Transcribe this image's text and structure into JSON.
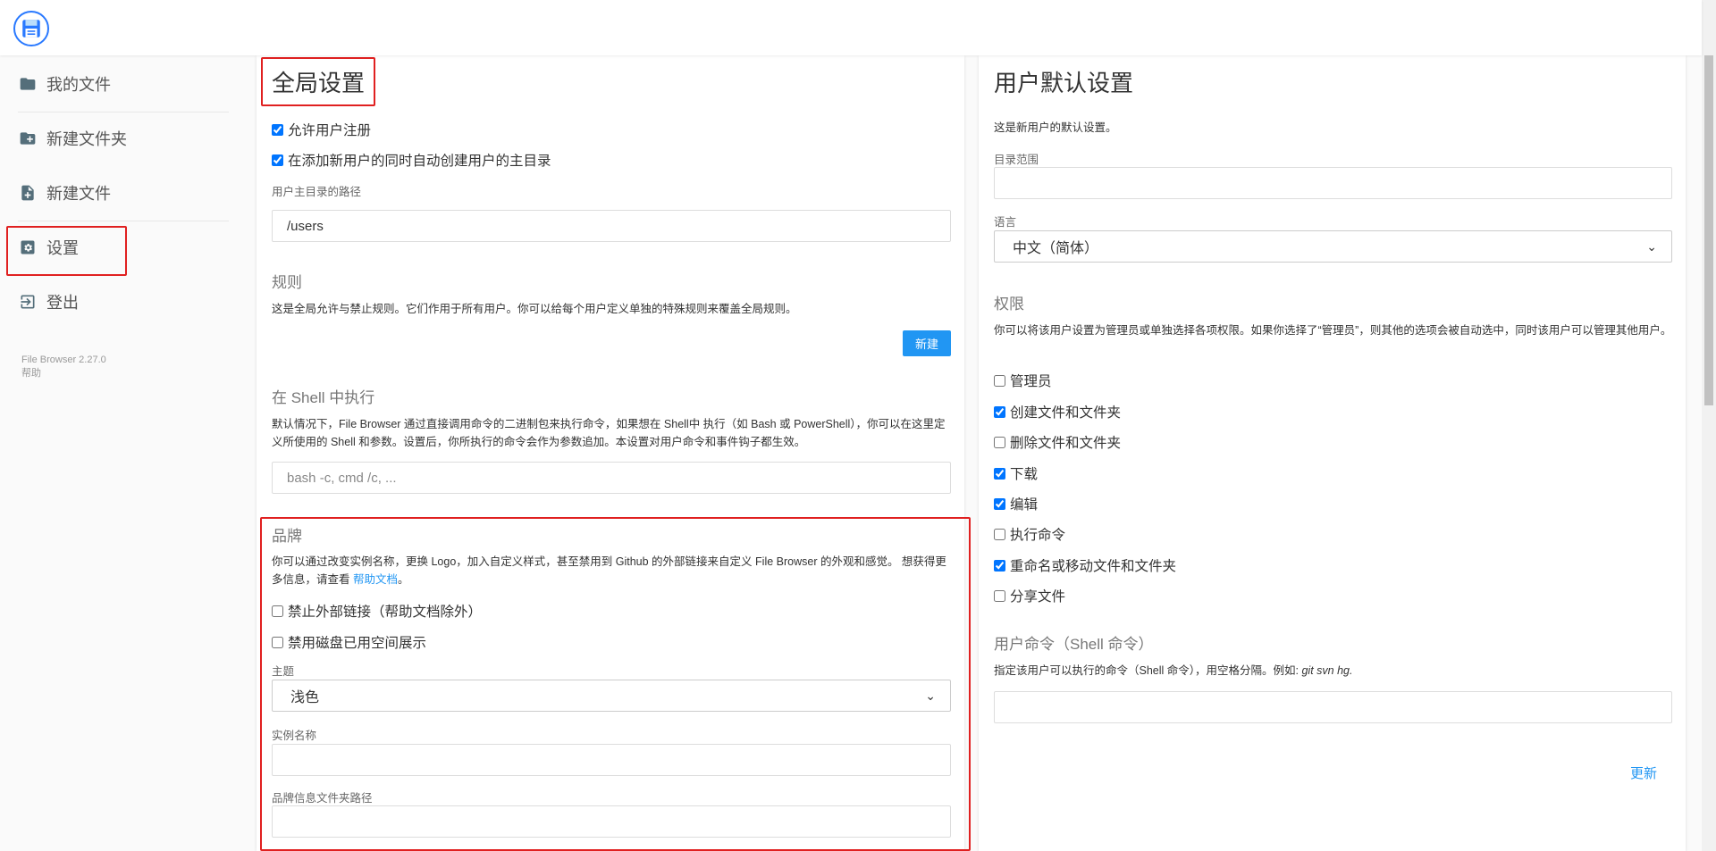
{
  "sidebar": {
    "items": [
      {
        "label": "我的文件",
        "icon": "folder-icon"
      },
      {
        "label": "新建文件夹",
        "icon": "folder-plus-icon"
      },
      {
        "label": "新建文件",
        "icon": "file-plus-icon"
      },
      {
        "label": "设置",
        "icon": "gear-icon"
      },
      {
        "label": "登出",
        "icon": "logout-icon"
      }
    ],
    "version": "File Browser 2.27.0",
    "help": "帮助"
  },
  "global": {
    "title": "全局设置",
    "allow_signup": "允许用户注册",
    "create_home": "在添加新用户的同时自动创建用户的主目录",
    "home_path_label": "用户主目录的路径",
    "home_path_value": "/users",
    "rules_title": "规则",
    "rules_desc": "这是全局允许与禁止规则。它们作用于所有用户。你可以给每个用户定义单独的特殊规则来覆盖全局规则。",
    "new_button": "新建",
    "shell_title": "在 Shell 中执行",
    "shell_desc": "默认情况下，File Browser 通过直接调用命令的二进制包来执行命令，如果想在 Shell中 执行（如 Bash 或 PowerShell），你可以在这里定义所使用的 Shell 和参数。设置后，你所执行的命令会作为参数追加。本设置对用户命令和事件钩子都生效。",
    "shell_placeholder": "bash -c, cmd /c, ...",
    "branding_title": "品牌",
    "branding_desc": "你可以通过改变实例名称，更换 Logo，加入自定义样式，甚至禁用到 Github 的外部链接来自定义 File Browser 的外观和感觉。 想获得更多信息，请查看",
    "branding_link": "帮助文档",
    "branding_end": "。",
    "disable_external": "禁止外部链接（帮助文档除外）",
    "disable_disk": "禁用磁盘已用空间展示",
    "theme_label": "主题",
    "theme_value": "浅色",
    "instance_label": "实例名称",
    "branding_dir_label": "品牌信息文件夹路径"
  },
  "defaults": {
    "title": "用户默认设置",
    "intro": "这是新用户的默认设置。",
    "scope_label": "目录范围",
    "lang_label": "语言",
    "lang_value": "中文（简体）",
    "perm_title": "权限",
    "perm_desc": "你可以将该用户设置为管理员或单独选择各项权限。如果你选择了“管理员”，则其他的选项会被自动选中，同时该用户可以管理其他用户。",
    "perms": [
      {
        "label": "管理员",
        "checked": false
      },
      {
        "label": "创建文件和文件夹",
        "checked": true
      },
      {
        "label": "删除文件和文件夹",
        "checked": false
      },
      {
        "label": "下载",
        "checked": true
      },
      {
        "label": "编辑",
        "checked": true
      },
      {
        "label": "执行命令",
        "checked": false
      },
      {
        "label": "重命名或移动文件和文件夹",
        "checked": true
      },
      {
        "label": "分享文件",
        "checked": false
      }
    ],
    "cmd_title": "用户命令（Shell 命令）",
    "cmd_desc": "指定该用户可以执行的命令（Shell 命令），用空格分隔。例如:",
    "cmd_example": "git svn hg.",
    "update_button": "更新"
  },
  "colors": {
    "accent": "#2196f3",
    "highlight": "#e02020"
  }
}
